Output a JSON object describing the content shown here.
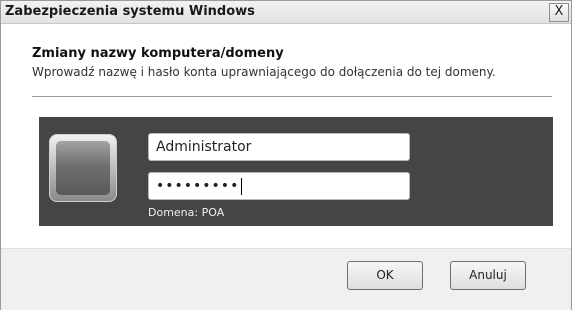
{
  "window": {
    "title": "Zabezpieczenia systemu Windows",
    "close_glyph": "X",
    "close_icon": "close-icon"
  },
  "dialog": {
    "heading": "Zmiany nazwy komputera/domeny",
    "instruction": "Wprowadź nazwę i hasło konta uprawniającego do dołączenia do tej domeny."
  },
  "credentials": {
    "user_tile_icon": "user-tile-icon",
    "username_value": "Administrator",
    "password_mask": "•••••••••",
    "domain_label": "Domena: POA"
  },
  "buttons": {
    "ok_label": "OK",
    "cancel_label": "Anuluj"
  },
  "colors": {
    "panel_background": "#454545",
    "footer_background": "#f0f0f0"
  }
}
